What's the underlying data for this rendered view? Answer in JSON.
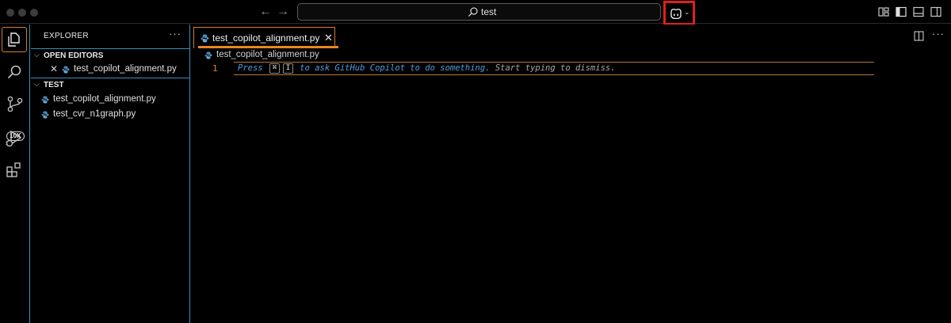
{
  "titlebar": {
    "search_text": "test",
    "search_icon": "search-icon",
    "copilot_icon": "copilot-icon",
    "copilot_chevron": "⌄",
    "nav_back": "←",
    "nav_forward": "→",
    "highlight_color": "#e0201b"
  },
  "activity_bar": {
    "items": [
      "explorer-icon",
      "search-icon",
      "source-control-icon",
      "run-debug-icon",
      "extensions-icon"
    ],
    "source_control_badge": "10K",
    "active_color": "#d77a2a"
  },
  "sidebar": {
    "title": "EXPLORER",
    "more": "···",
    "open_editors": {
      "label": "OPEN EDITORS",
      "files": [
        {
          "name": "test_copilot_alignment.py",
          "close": "✕"
        }
      ]
    },
    "folder": {
      "label": "TEST",
      "files": [
        {
          "name": "test_copilot_alignment.py"
        },
        {
          "name": "test_cvr_n1graph.py"
        }
      ]
    }
  },
  "editor": {
    "tab": {
      "name": "test_copilot_alignment.py",
      "close": "✕"
    },
    "breadcrumb": "test_copilot_alignment.py",
    "line_number": "1",
    "hint": {
      "press": "Press",
      "key1": "⌘",
      "key2": "I",
      "ask": "to ask GitHub Copilot to do something.",
      "dismiss": "Start typing to dismiss."
    },
    "accent_color": "#e8871e",
    "more": "···"
  }
}
